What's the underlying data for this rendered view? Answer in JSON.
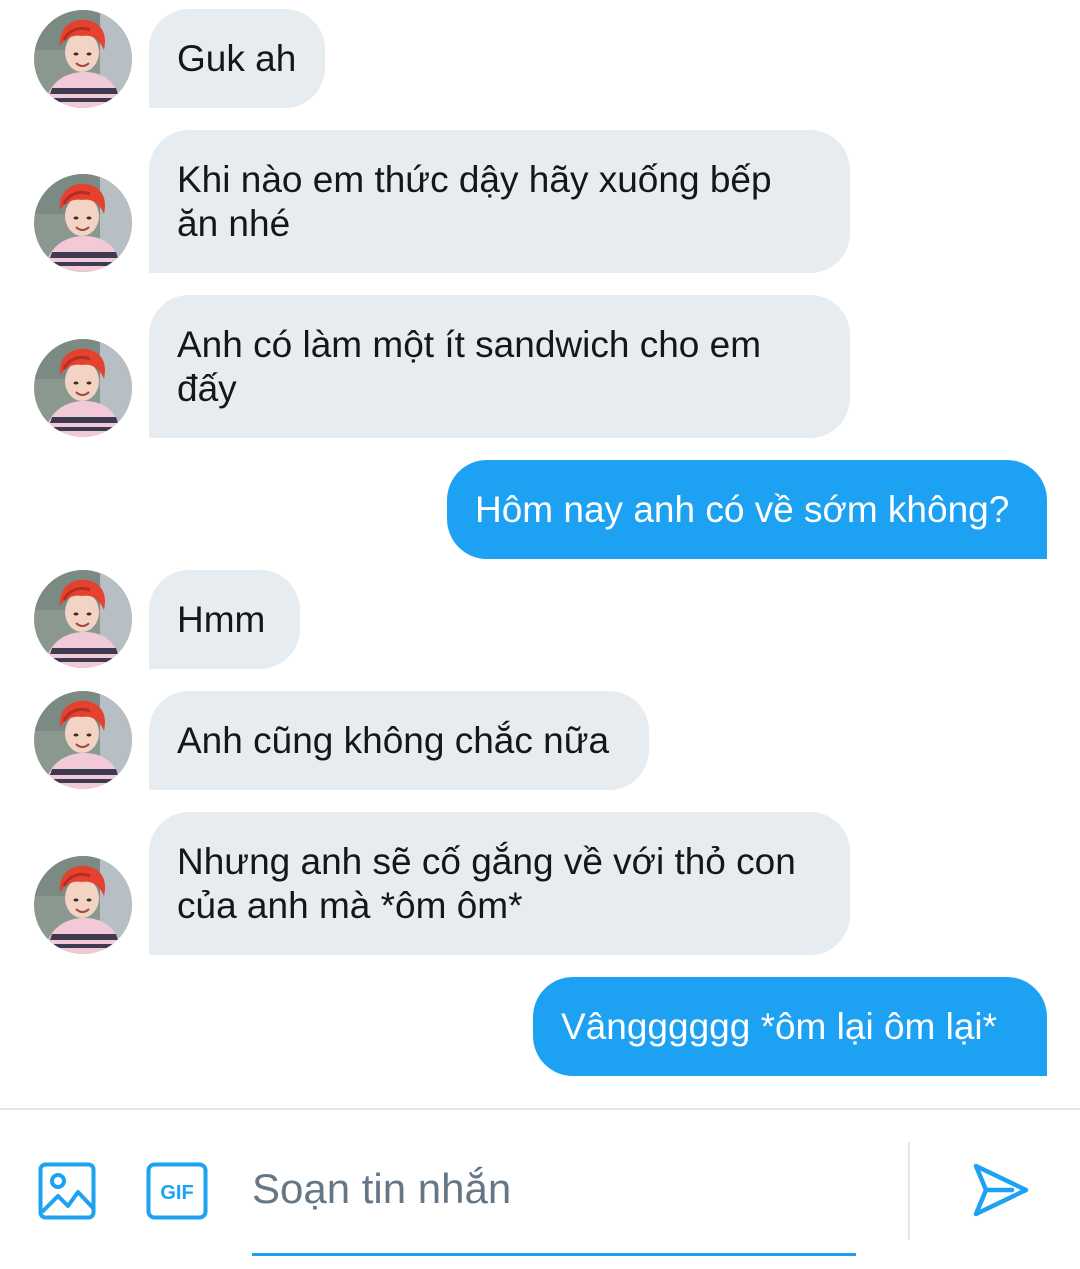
{
  "colors": {
    "accent": "#1da1f2",
    "incoming_bubble": "#e6ecf0",
    "outgoing_bubble": "#1da1f2"
  },
  "messages": [
    {
      "direction": "in",
      "text": "Guk ah"
    },
    {
      "direction": "in",
      "text": "Khi nào em thức dậy hãy xuống bếp\năn nhé"
    },
    {
      "direction": "in",
      "text": "Anh có làm một ít sandwich cho em\nđấy"
    },
    {
      "direction": "out",
      "text": "Hôm nay anh có về sớm không?"
    },
    {
      "direction": "in",
      "text": "Hmm"
    },
    {
      "direction": "in",
      "text": "Anh cũng không chắc nữa"
    },
    {
      "direction": "in",
      "text": "Nhưng anh sẽ cố gắng về với thỏ con\ncủa anh mà *ôm ôm*"
    },
    {
      "direction": "out",
      "text": "Vângggggg *ôm lại ôm lại*"
    }
  ],
  "composer": {
    "placeholder": "Soạn tin nhắn",
    "image_icon": "image-icon",
    "gif_icon": "gif-icon",
    "gif_label": "GIF",
    "send_icon": "send-icon"
  }
}
